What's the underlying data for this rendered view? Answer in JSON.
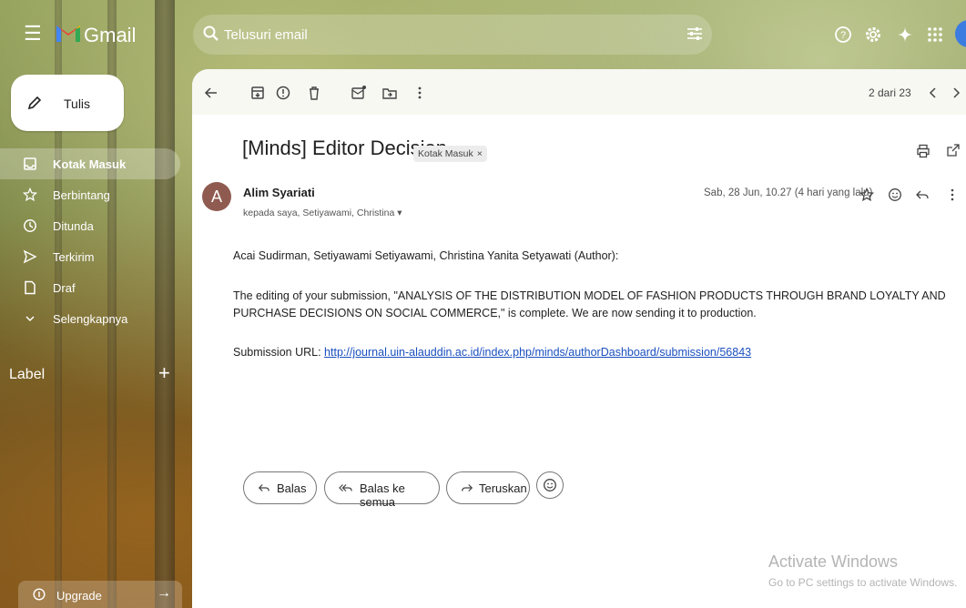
{
  "app": {
    "name": "Gmail"
  },
  "search": {
    "placeholder": "Telusuri email"
  },
  "compose": {
    "label": "Tulis"
  },
  "sidebar": {
    "items": [
      {
        "label": "Kotak Masuk",
        "icon": "inbox-icon",
        "active": true
      },
      {
        "label": "Berbintang",
        "icon": "star-icon"
      },
      {
        "label": "Ditunda",
        "icon": "clock-icon"
      },
      {
        "label": "Terkirim",
        "icon": "send-icon"
      },
      {
        "label": "Draf",
        "icon": "draft-icon"
      },
      {
        "label": "Selengkapnya",
        "icon": "chevron-down-icon"
      }
    ],
    "labels_header": "Label",
    "upgrade": "Upgrade"
  },
  "toolbar": {
    "pager": "2 dari 23"
  },
  "email": {
    "subject": "[Minds] Editor Decision",
    "chip": "Kotak Masuk",
    "chip_close": "×",
    "sender": "Alim Syariati",
    "avatar_letter": "A",
    "recipients": "kepada saya, Setiyawami, Christina ▾",
    "date": "Sab, 28 Jun, 10.27 (4 hari yang lalu)",
    "body_1": "Acai Sudirman, Setiyawami Setiyawami, Christina Yanita Setyawati (Author):",
    "body_2": "The editing of your submission, \"ANALYSIS OF THE DISTRIBUTION MODEL OF FASHION PRODUCTS THROUGH BRAND LOYALTY AND PURCHASE DECISIONS ON SOCIAL COMMERCE,\" is complete. We are now sending it to production.",
    "body_3_label": "Submission URL: ",
    "body_3_link": "http://journal.uin-alauddin.ac.id/index.php/minds/authorDashboard/submission/56843"
  },
  "actions": {
    "reply": "Balas",
    "reply_all": "Balas ke semua",
    "forward": "Teruskan"
  },
  "watermark": {
    "line1": "Activate Windows",
    "line2": "Go to PC settings to activate Windows."
  }
}
